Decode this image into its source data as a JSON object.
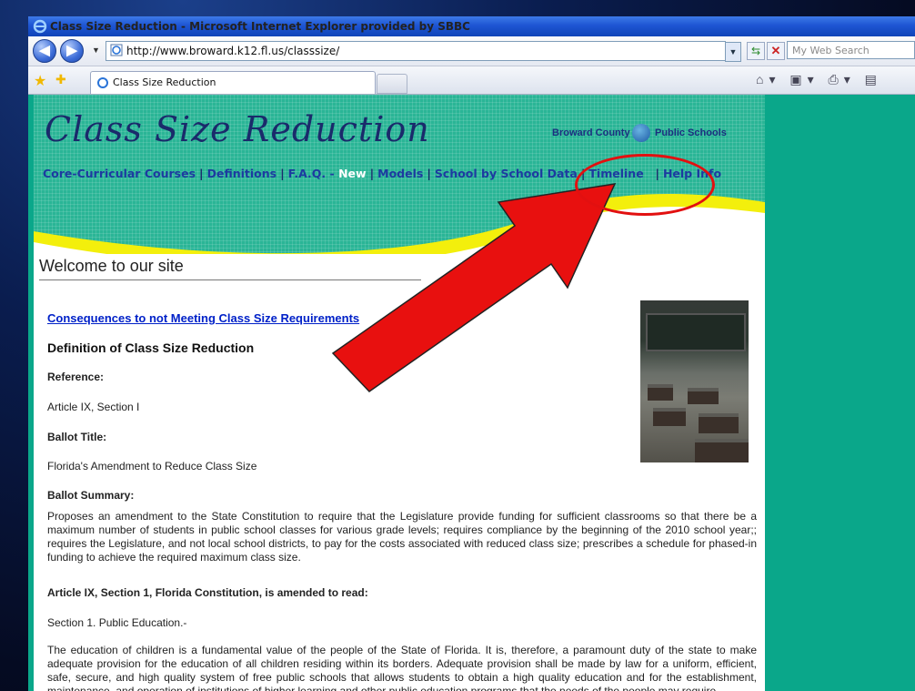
{
  "window": {
    "title": "Class Size Reduction - Microsoft Internet Explorer provided by SBBC"
  },
  "toolbar": {
    "back_label": "◀",
    "forward_label": "▶",
    "url": "http://www.broward.k12.fl.us/classsize/",
    "search_placeholder": "My Web Search"
  },
  "tabs": [
    {
      "label": "Class Size Reduction"
    }
  ],
  "page": {
    "site_title": "Class Size Reduction",
    "district_name": "Broward County",
    "district_suffix": "Public Schools",
    "nav": {
      "core": "Core-Curricular Courses",
      "definitions": "Definitions",
      "faq": "F.A.Q.",
      "dash": " - ",
      "new": "New",
      "models": "Models",
      "school_data": "School by School Data",
      "timeline": "Timeline",
      "help": "Help Info"
    },
    "welcome": "Welcome to our site",
    "consequences_link": "Consequences to not Meeting Class Size Requirements",
    "definition_heading": "Definition of Class Size Reduction",
    "reference_label": "Reference:",
    "reference_value": "Article IX, Section I",
    "ballot_title_label": "Ballot Title:",
    "ballot_title_value": "Florida's Amendment to Reduce Class Size",
    "ballot_summary_label": "Ballot Summary:",
    "ballot_summary_text": "Proposes an amendment to the State Constitution to require that the Legislature provide funding for sufficient classrooms so that there be a maximum number of students in public school classes for various grade levels; requires compliance by the beginning of the 2010 school year;; requires the Legislature, and not local school districts, to pay for the costs associated with reduced class size; prescribes a schedule for phased-in funding to achieve the required maximum class size.",
    "article_heading": "Article IX, Section 1, Florida Constitution, is amended to read:",
    "section_label": "Section 1. Public Education.-",
    "education_text": "The education of children is a fundamental value of the people of the State of Florida. It is, therefore, a paramount duty of the state to make adequate provision for the education of all children residing within its borders. Adequate provision shall be made by law for a uniform, efficient, safe, secure, and high quality system of free public schools that allows students to obtain a high quality education and for the establishment, maintenance, and operation of institutions of higher learning and other public education programs that the needs of the people may require."
  },
  "overlay": {
    "arrow_color": "#e8100f",
    "circle_color": "#e21010"
  }
}
